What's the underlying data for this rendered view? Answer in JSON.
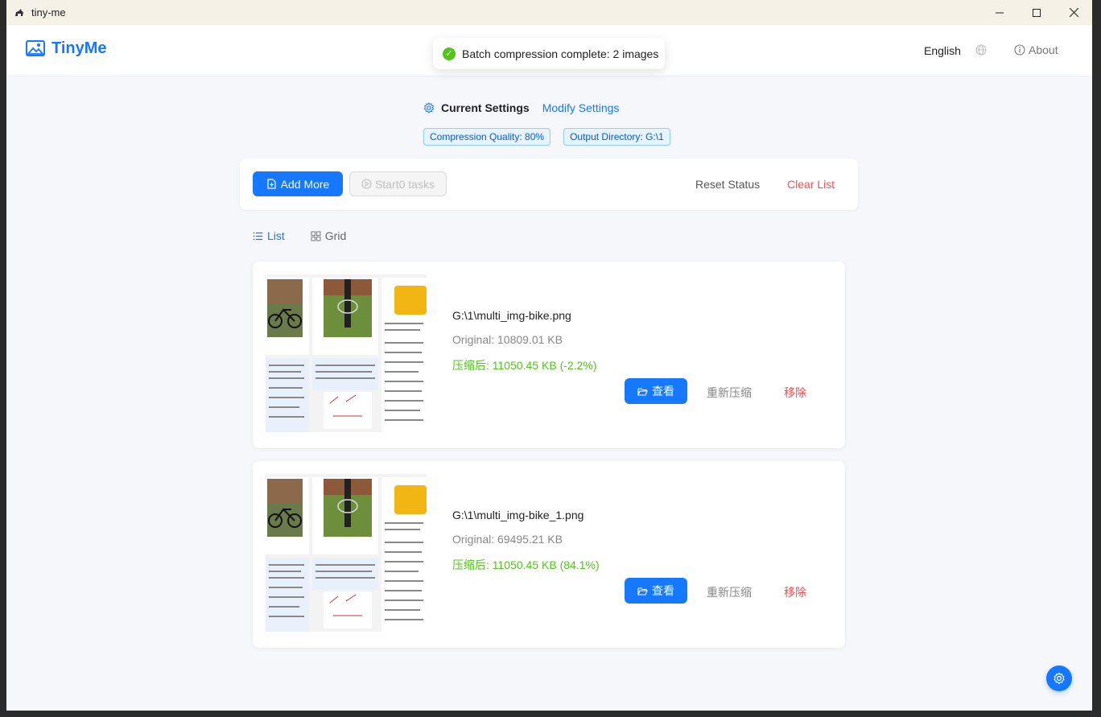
{
  "window": {
    "title": "tiny-me"
  },
  "header": {
    "brand": "TinyMe",
    "language": "English",
    "about": "About"
  },
  "toast": {
    "message": "Batch compression complete: 2 images"
  },
  "settings": {
    "label": "Current Settings",
    "modify_link": "Modify Settings",
    "tags": [
      "Compression Quality: 80%",
      "Output Directory: G:\\1"
    ]
  },
  "toolbar": {
    "add_more": "Add More",
    "start": "Start0 tasks",
    "reset": "Reset Status",
    "clear": "Clear List"
  },
  "view_tabs": {
    "list": "List",
    "grid": "Grid",
    "active": "list"
  },
  "files": [
    {
      "path": "G:\\1\\multi_img-bike.png",
      "original": "Original: 10809.01 KB",
      "compressed": "压缩后: 11050.45 KB (-2.2%)",
      "view": "查看",
      "recompress": "重新压缩",
      "remove": "移除"
    },
    {
      "path": "G:\\1\\multi_img-bike_1.png",
      "original": "Original: 69495.21 KB",
      "compressed": "压缩后: 11050.45 KB (84.1%)",
      "view": "查看",
      "recompress": "重新压缩",
      "remove": "移除"
    }
  ],
  "colors": {
    "accent": "#1677ff",
    "success": "#52c41a",
    "danger": "#ff4d4f"
  }
}
